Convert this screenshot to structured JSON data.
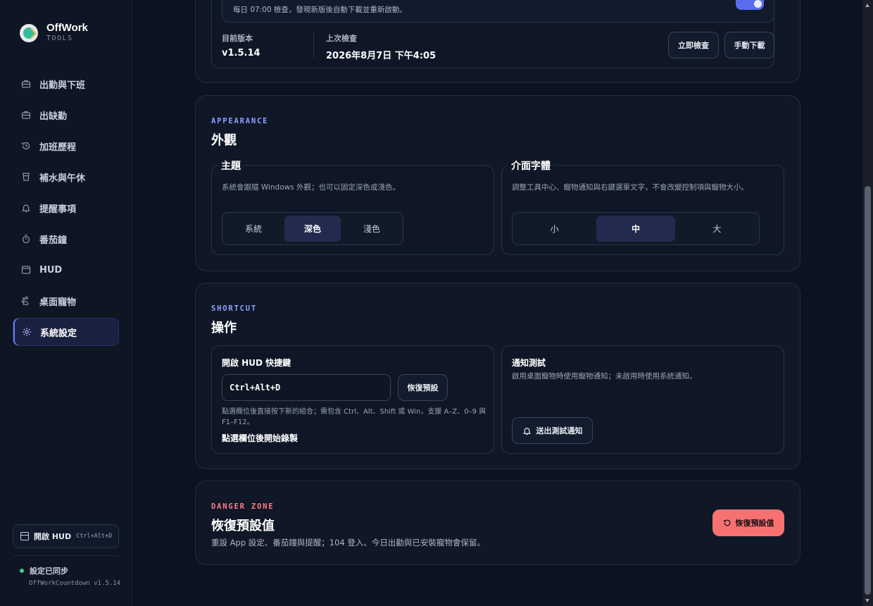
{
  "brand": {
    "title": "OffWork",
    "subtitle": "TOOLS"
  },
  "nav": [
    {
      "label": "出勤與下班",
      "icon": "briefcase-icon"
    },
    {
      "label": "出缺勤",
      "icon": "briefcase-icon"
    },
    {
      "label": "加班歷程",
      "icon": "history-icon"
    },
    {
      "label": "補水與午休",
      "icon": "cup-icon"
    },
    {
      "label": "提醒事項",
      "icon": "bell-icon"
    },
    {
      "label": "番茄鐘",
      "icon": "timer-icon"
    },
    {
      "label": "HUD",
      "icon": "window-icon"
    },
    {
      "label": "桌面寵物",
      "icon": "paw-icon"
    },
    {
      "label": "系統設定",
      "icon": "gear-icon",
      "active": true
    }
  ],
  "sidebar_footer": {
    "hud_button": "開啟 HUD",
    "hud_shortcut": "Ctrl+Alt+D",
    "sync_status": "設定已同步",
    "version": "OffWorkCountdown v1.5.14"
  },
  "update": {
    "notice": "每日 07:00 檢查，發現新版後自動下載並重新啟動。",
    "current_version_label": "目前版本",
    "current_version": "v1.5.14",
    "last_check_label": "上次檢查",
    "last_check": "2026年8月7日 下午4:05",
    "check_now": "立即檢查",
    "manual_download": "手動下載"
  },
  "appearance": {
    "eyebrow": "APPEARANCE",
    "title": "外觀",
    "theme": {
      "title": "主題",
      "desc": "系統會跟隨 Windows 外觀；也可以固定深色或淺色。",
      "options": [
        "系統",
        "深色",
        "淺色"
      ],
      "selected": "深色"
    },
    "font": {
      "title": "介面字體",
      "desc": "調整工具中心、寵物通知與右鍵選單文字，不會改變控制項與寵物大小。",
      "options": [
        "小",
        "中",
        "大"
      ],
      "selected": "中"
    }
  },
  "shortcut": {
    "eyebrow": "SHORTCUT",
    "title": "操作",
    "hud_key": {
      "title": "開啟 HUD 快捷鍵",
      "value": "Ctrl+Alt+D",
      "reset": "恢復預設",
      "hint": "點選欄位後直接按下新的組合；需包含 Ctrl、Alt、Shift 或 Win，支援 A–Z、0–9 與 F1–F12。",
      "status": "點選欄位後開始錄製"
    },
    "notify": {
      "title": "通知測試",
      "desc": "啟用桌面寵物時使用寵物通知；未啟用時使用系統通知。",
      "button": "送出測試通知"
    }
  },
  "danger": {
    "eyebrow": "DANGER ZONE",
    "title": "恢復預設值",
    "desc": "重設 App 設定、番茄鐘與提醒；104 登入、今日出勤與已安裝寵物會保留。",
    "button": "恢復預設值"
  },
  "colors": {
    "accent": "#6a7cff",
    "danger": "#f87171",
    "danger_label": "#ff7a8a",
    "sync_dot": "#3fd08b"
  }
}
